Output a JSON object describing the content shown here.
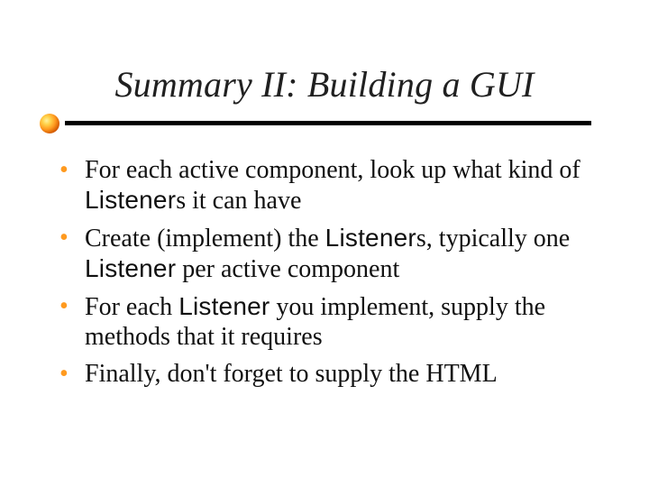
{
  "title": "Summary II: Building a GUI",
  "code_word": "Listener",
  "code_word_plural_suffix": "s",
  "bullets": [
    {
      "pre": "For each active component, look up what kind of ",
      "code": "Listener",
      "post": "s it can have"
    },
    {
      "pre": "Create (implement) the ",
      "code": "Listener",
      "mid": "s, typically one ",
      "code2": "Listener",
      "post": " per active component"
    },
    {
      "pre": "For each ",
      "code": "Listener",
      "post": " you implement, supply the methods that it requires"
    },
    {
      "pre": "Finally, don't forget to supply the HTML",
      "code": "",
      "post": ""
    }
  ]
}
